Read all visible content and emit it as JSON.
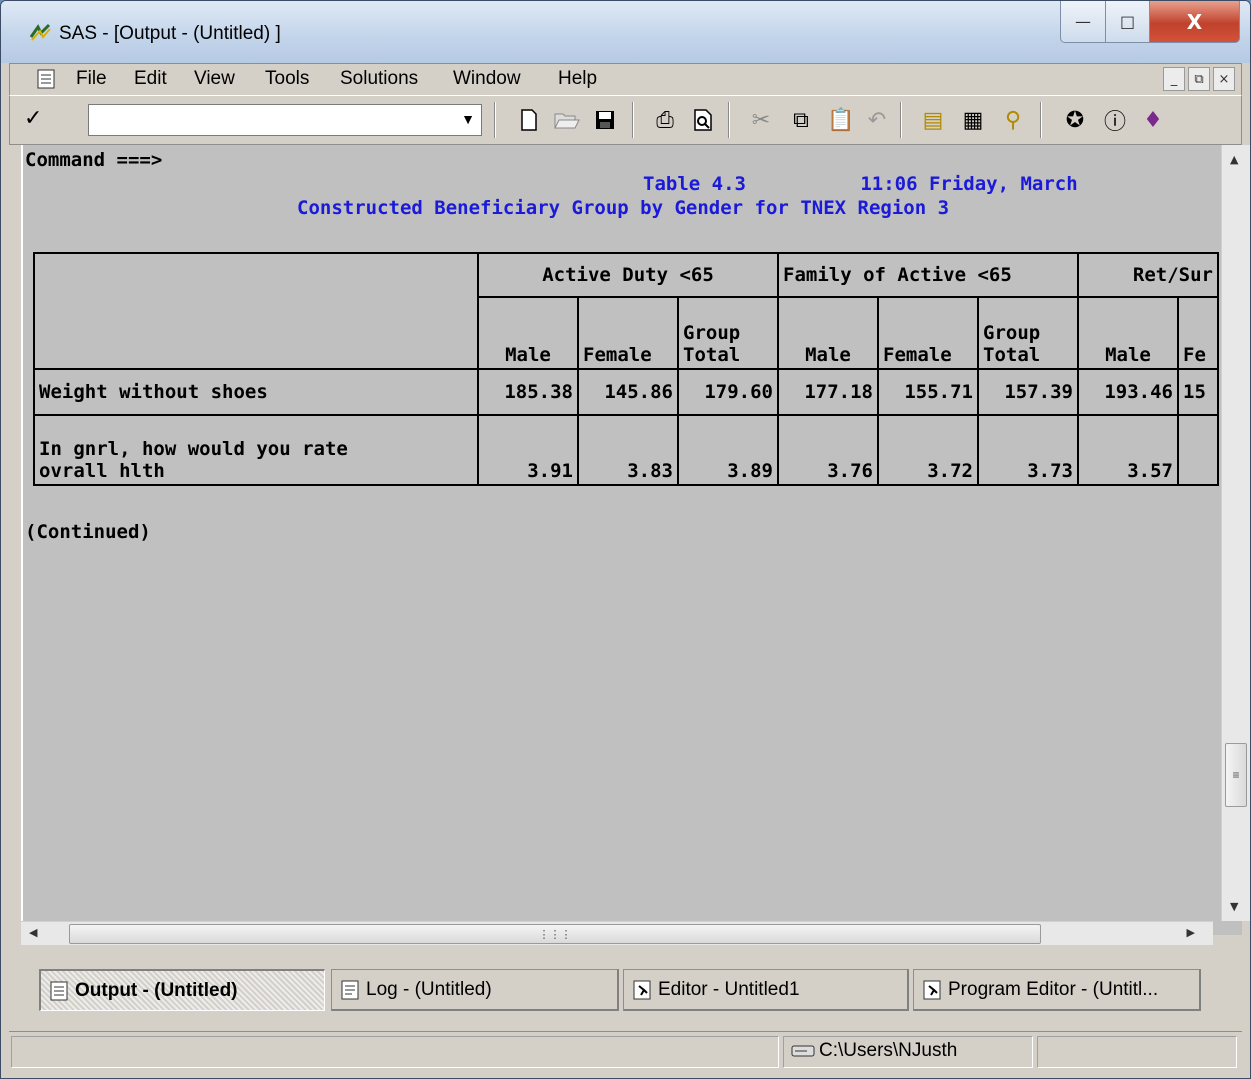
{
  "window": {
    "title": "SAS - [Output - (Untitled) ]"
  },
  "menu": {
    "items": [
      "File",
      "Edit",
      "View",
      "Tools",
      "Solutions",
      "Window",
      "Help"
    ]
  },
  "toolbar": {
    "command_value": ""
  },
  "output": {
    "command_prompt": "Command ===>",
    "title_line1": "Table 4.3          11:06 Friday, March",
    "title_line2": "Constructed Beneficiary Group by Gender for TNEX Region 3",
    "groups": [
      "Active Duty <65",
      "Family of Active <65",
      "Ret/Sur"
    ],
    "col_headers": [
      "Male",
      "Female",
      "Group\nTotal",
      "Male",
      "Female",
      "Group\nTotal",
      "Male",
      "Fe"
    ],
    "rows": [
      {
        "label": "Weight without shoes",
        "values": [
          "185.38",
          "145.86",
          "179.60",
          "177.18",
          "155.71",
          "157.39",
          "193.46",
          "15"
        ]
      },
      {
        "label": "In gnrl, how would you rate\novrall hlth",
        "values": [
          "3.91",
          "3.83",
          "3.89",
          "3.76",
          "3.72",
          "3.73",
          "3.57",
          ""
        ]
      }
    ],
    "continued": "(Continued)"
  },
  "window_tabs": [
    {
      "label": "Output - (Untitled)",
      "icon": "output-doc-icon",
      "active": true
    },
    {
      "label": "Log - (Untitled)",
      "icon": "log-doc-icon",
      "active": false
    },
    {
      "label": "Editor - Untitled1",
      "icon": "editor-run-icon",
      "active": false
    },
    {
      "label": "Program Editor - (Untitl...",
      "icon": "program-editor-icon",
      "active": false
    }
  ],
  "status": {
    "path": "C:\\Users\\NJusth"
  }
}
